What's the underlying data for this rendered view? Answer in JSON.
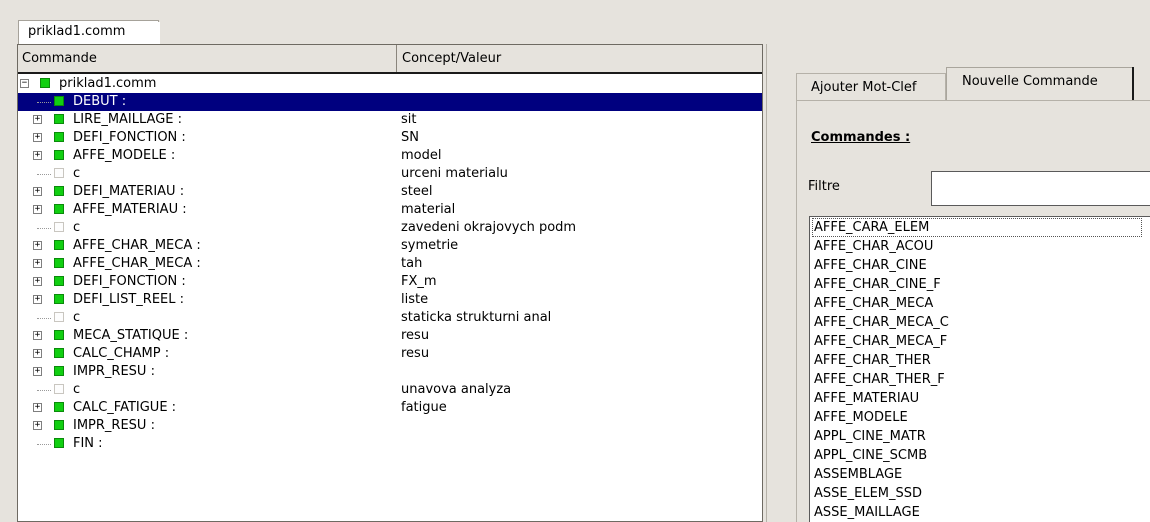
{
  "file_tab": {
    "label": "priklad1.comm"
  },
  "tree": {
    "headers": {
      "command": "Commande",
      "value": "Concept/Valeur"
    },
    "root_label": "priklad1.comm",
    "rows": [
      {
        "cmd": "DEBUT :",
        "val": "",
        "kind": "leaf",
        "selected": true
      },
      {
        "cmd": "LIRE_MAILLAGE :",
        "val": "sit",
        "kind": "expandable"
      },
      {
        "cmd": "DEFI_FONCTION :",
        "val": "SN",
        "kind": "expandable"
      },
      {
        "cmd": "AFFE_MODELE :",
        "val": "model",
        "kind": "expandable"
      },
      {
        "cmd": "c",
        "val": "urceni materialu",
        "kind": "comment"
      },
      {
        "cmd": "DEFI_MATERIAU :",
        "val": "steel",
        "kind": "expandable"
      },
      {
        "cmd": "AFFE_MATERIAU :",
        "val": "material",
        "kind": "expandable"
      },
      {
        "cmd": "c",
        "val": "zavedeni okrajovych podm",
        "kind": "comment"
      },
      {
        "cmd": "AFFE_CHAR_MECA :",
        "val": "symetrie",
        "kind": "expandable"
      },
      {
        "cmd": "AFFE_CHAR_MECA :",
        "val": "tah",
        "kind": "expandable"
      },
      {
        "cmd": "DEFI_FONCTION :",
        "val": "FX_m",
        "kind": "expandable"
      },
      {
        "cmd": "DEFI_LIST_REEL :",
        "val": "liste",
        "kind": "expandable"
      },
      {
        "cmd": "c",
        "val": "staticka strukturni anal",
        "kind": "comment"
      },
      {
        "cmd": "MECA_STATIQUE :",
        "val": "resu",
        "kind": "expandable"
      },
      {
        "cmd": "CALC_CHAMP :",
        "val": "resu",
        "kind": "expandable"
      },
      {
        "cmd": "IMPR_RESU :",
        "val": "",
        "kind": "expandable"
      },
      {
        "cmd": "c",
        "val": "unavova analyza",
        "kind": "comment"
      },
      {
        "cmd": "CALC_FATIGUE :",
        "val": "fatigue",
        "kind": "expandable"
      },
      {
        "cmd": "IMPR_RESU :",
        "val": "",
        "kind": "expandable"
      },
      {
        "cmd": "FIN :",
        "val": "",
        "kind": "leaf"
      }
    ]
  },
  "right": {
    "tabs": {
      "add_keyword": "Ajouter Mot-Clef",
      "new_command": "Nouvelle Commande"
    },
    "commands_title": "Commandes :",
    "filter_label": "Filtre",
    "filter_value": "",
    "commands": [
      "AFFE_CARA_ELEM",
      "AFFE_CHAR_ACOU",
      "AFFE_CHAR_CINE",
      "AFFE_CHAR_CINE_F",
      "AFFE_CHAR_MECA",
      "AFFE_CHAR_MECA_C",
      "AFFE_CHAR_MECA_F",
      "AFFE_CHAR_THER",
      "AFFE_CHAR_THER_F",
      "AFFE_MATERIAU",
      "AFFE_MODELE",
      "APPL_CINE_MATR",
      "APPL_CINE_SCMB",
      "ASSEMBLAGE",
      "ASSE_ELEM_SSD",
      "ASSE_MAILLAGE"
    ]
  },
  "colors": {
    "selection": "#00007f",
    "status_ok": "#11cf11",
    "panel_bg": "#e6e3dd"
  }
}
